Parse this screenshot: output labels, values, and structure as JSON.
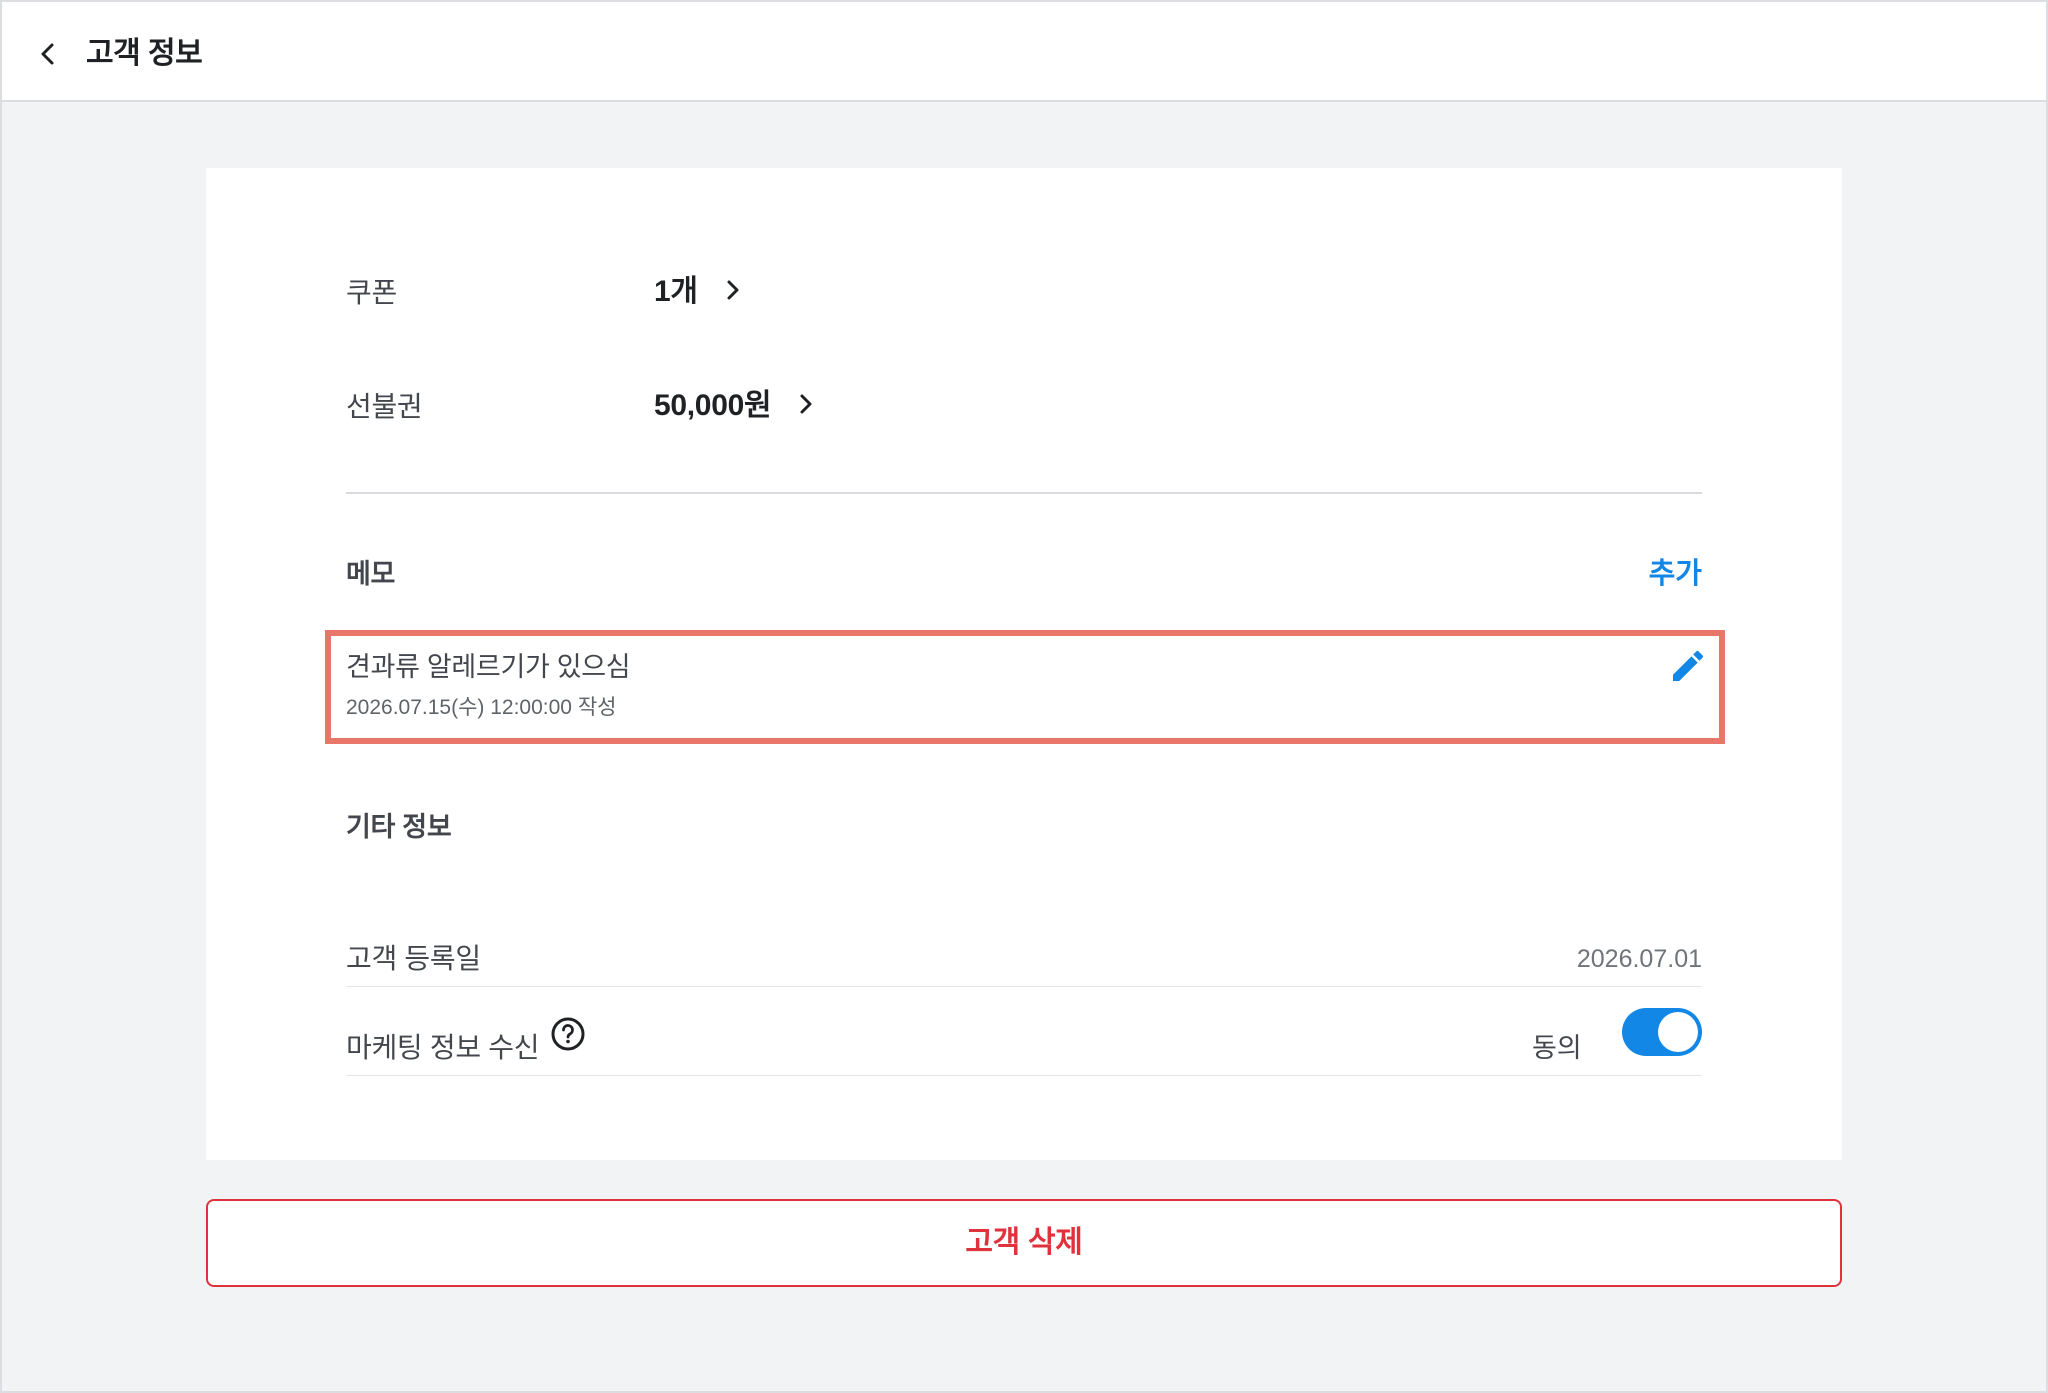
{
  "header": {
    "title": "고객 정보"
  },
  "benefits": {
    "coupon_label": "쿠폰",
    "coupon_value": "1개",
    "prepaid_label": "선불권",
    "prepaid_value": "50,000원"
  },
  "memo": {
    "section_title": "메모",
    "add_label": "추가",
    "items": [
      {
        "text": "견과류 알레르기가 있으심",
        "date": "2026.07.15(수) 12:00:00 작성"
      }
    ]
  },
  "other": {
    "section_title": "기타 정보",
    "registration_label": "고객 등록일",
    "registration_date": "2026.07.01",
    "marketing_label": "마케팅 정보 수신",
    "marketing_status": "동의",
    "marketing_enabled": true
  },
  "actions": {
    "delete_label": "고객 삭제"
  },
  "colors": {
    "accent": "#1387e5",
    "danger": "#e0323c",
    "highlight": "#e8776a",
    "background": "#f2f3f5"
  }
}
